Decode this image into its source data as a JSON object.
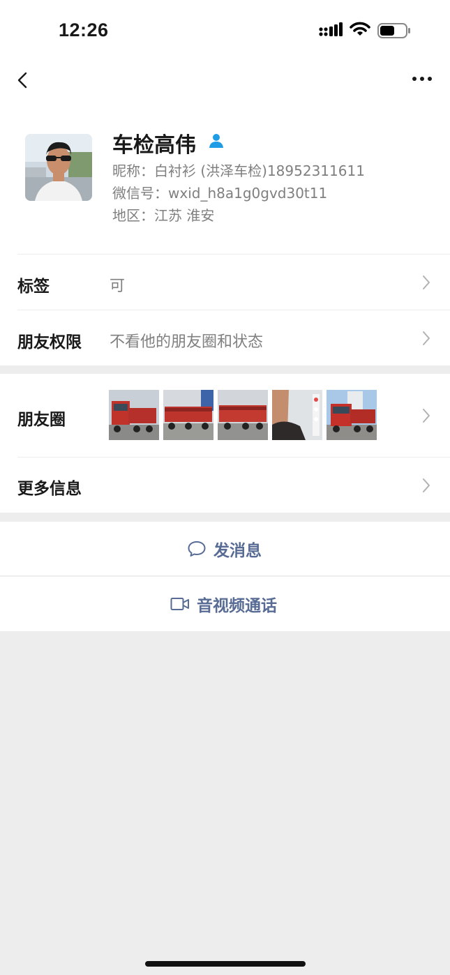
{
  "status_bar": {
    "time": "12:26",
    "signal_icon": "signal-bars-icon",
    "wifi_icon": "wifi-icon",
    "battery_icon": "battery-icon"
  },
  "nav": {
    "back_icon": "chevron-left-icon",
    "more_icon": "ellipsis-icon"
  },
  "profile": {
    "display_name": "车检高伟",
    "nickname": "昵称：白衬衫 (洪泽车检)18952311611",
    "wechat_id": "微信号：wxid_h8a1g0gvd30t11",
    "region": "地区：江苏 淮安",
    "badge_icon": "person-icon"
  },
  "tags_row": {
    "label": "标签",
    "value": "可"
  },
  "permissions_row": {
    "label": "朋友权限",
    "value": "不看他的朋友圈和状态"
  },
  "moments_row": {
    "label": "朋友圈",
    "thumbnails": [
      "red-truck-photo",
      "flatbed-truck-photo",
      "flatbed-truck-photo",
      "selfie-photo",
      "red-truck-photo"
    ]
  },
  "more_info_row": {
    "label": "更多信息"
  },
  "actions": {
    "message": {
      "label": "发消息",
      "icon": "chat-bubble-icon"
    },
    "call": {
      "label": "音视频通话",
      "icon": "video-camera-icon"
    }
  },
  "colors": {
    "link": "#576b95",
    "page_bg": "#ededed",
    "badge": "#1e9ce6"
  }
}
